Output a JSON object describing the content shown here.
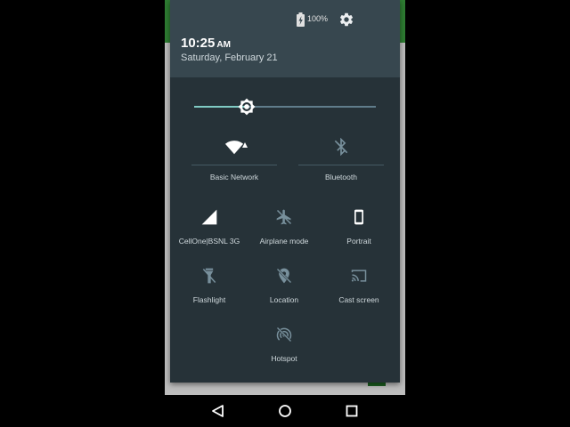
{
  "status": {
    "battery_percent": "100%",
    "battery_icon": "battery-charging-icon",
    "settings_icon": "gear-icon"
  },
  "header": {
    "time": "10:25",
    "ampm": "AM",
    "date": "Saturday, February 21"
  },
  "brightness": {
    "level_fraction": 0.29,
    "icon": "brightness-icon"
  },
  "tiles": {
    "wifi": {
      "label": "Basic Network",
      "icon": "wifi-icon"
    },
    "bluetooth": {
      "label": "Bluetooth",
      "icon": "bluetooth-off-icon"
    },
    "cellular": {
      "label": "CellOne|BSNL 3G",
      "icon": "cell-signal-icon"
    },
    "airplane": {
      "label": "Airplane mode",
      "icon": "airplane-icon"
    },
    "rotation": {
      "label": "Portrait",
      "icon": "portrait-icon"
    },
    "flashlight": {
      "label": "Flashlight",
      "icon": "flashlight-icon"
    },
    "location": {
      "label": "Location",
      "icon": "location-off-icon"
    },
    "cast": {
      "label": "Cast screen",
      "icon": "cast-icon"
    },
    "hotspot": {
      "label": "Hotspot",
      "icon": "hotspot-off-icon"
    }
  },
  "colors": {
    "panel_bg": "#263238",
    "header_bg": "#37474f",
    "accent": "#80cbc4",
    "inactive_icon": "#78909c"
  },
  "navbar": {
    "back_icon": "back-icon",
    "home_icon": "home-icon",
    "recents_icon": "recents-icon"
  }
}
